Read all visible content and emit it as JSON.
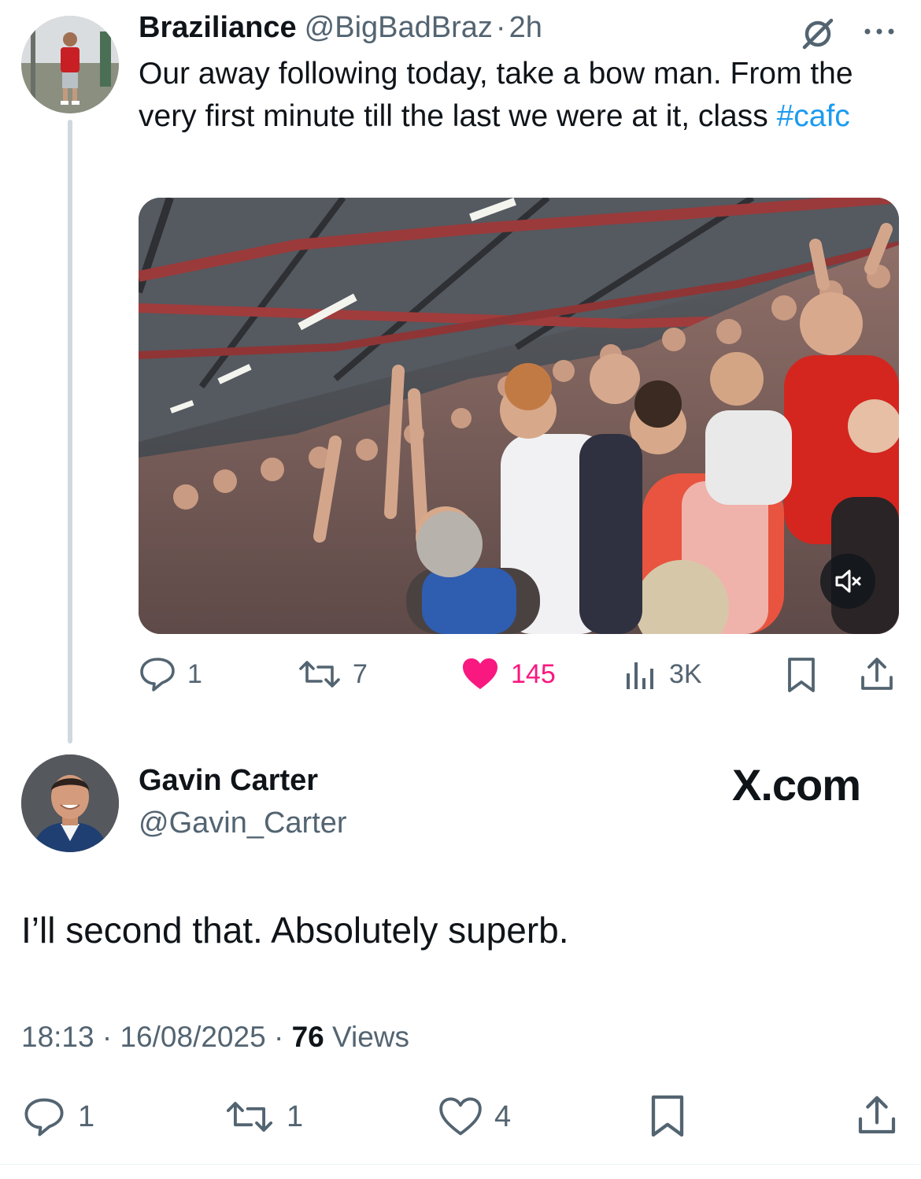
{
  "quoted_tweet": {
    "author_name": "Braziliance",
    "handle": "@BigBadBraz",
    "separator": "·",
    "time": "2h",
    "text_main": "Our away following today, take a bow man. From the very first minute till the last we were at it, class",
    "hashtag": "#cafc",
    "media": {
      "type": "video",
      "muted": true
    },
    "actions": {
      "replies": "1",
      "reposts": "7",
      "likes": "145",
      "views": "3K"
    },
    "like_color": "#f91880"
  },
  "reply_tweet": {
    "author_name": "Gavin Carter",
    "handle": "@Gavin_Carter",
    "brand": "X.com",
    "text": "I’ll second that. Absolutely superb.",
    "time": "18:13",
    "dot1": "·",
    "date": "16/08/2025",
    "dot2": "·",
    "views_count": "76",
    "views_label": "Views",
    "actions": {
      "replies": "1",
      "reposts": "1",
      "likes": "4"
    }
  },
  "colors": {
    "accent": "#1d9bf0",
    "muted": "#536471",
    "thread_line": "#cfd9de"
  },
  "icons": [
    "grok-slash-icon",
    "more-icon",
    "mute-icon",
    "reply-icon",
    "repost-icon",
    "like-icon",
    "views-icon",
    "bookmark-icon",
    "share-icon"
  ]
}
